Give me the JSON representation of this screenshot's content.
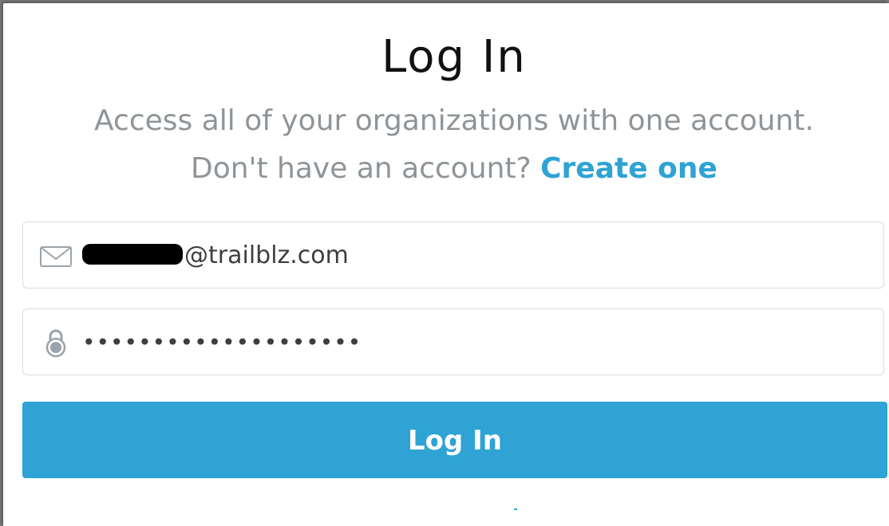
{
  "header": {
    "title": "Log In",
    "subtitle": "Access all of your organizations with one account.",
    "signup_prompt": "Don't have an account?",
    "signup_link": "Create one"
  },
  "form": {
    "email_value_suffix": "@trailblz.com",
    "email_icon": "envelope-icon",
    "password_value": "••••••••••••••••••••",
    "password_icon": "lock-icon",
    "submit_label": "Log In"
  },
  "colors": {
    "accent": "#2ea3d4",
    "muted_text": "#8e9498",
    "title_text": "#111111",
    "border": "#d8dbde"
  }
}
